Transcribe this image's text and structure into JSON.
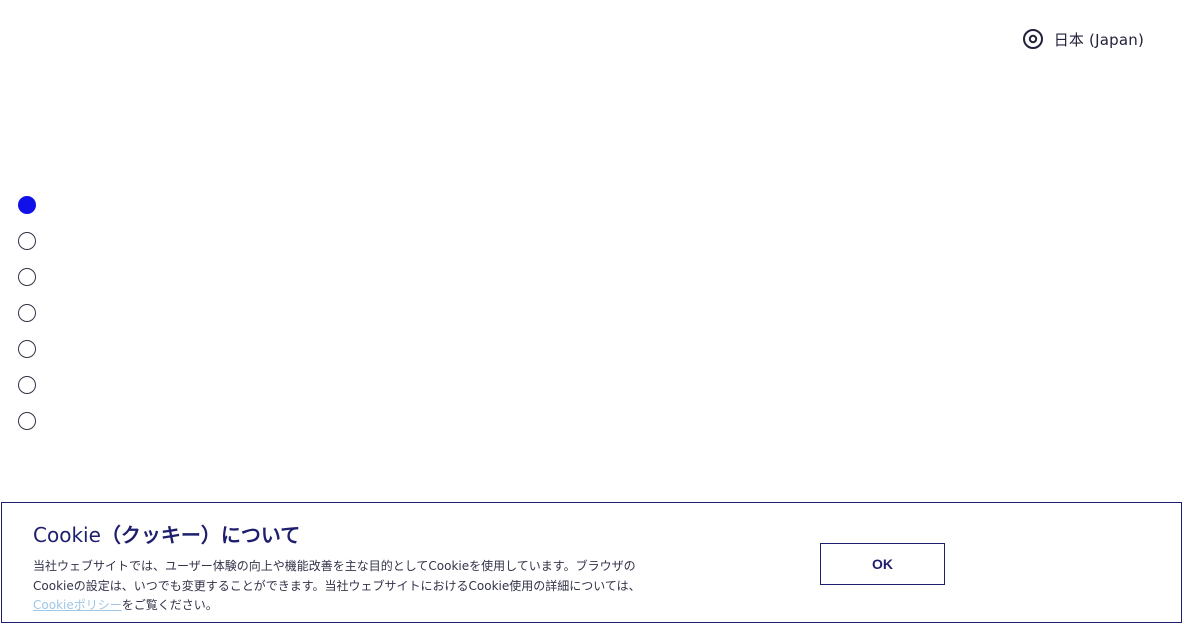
{
  "header": {
    "region_label": "日本 (Japan)",
    "region_icon": "location-pin-icon"
  },
  "carousel": {
    "total_slides": 7,
    "active_index": 0,
    "active_color": "#1010e8"
  },
  "cookie_banner": {
    "title_prefix": "Cookie",
    "title_suffix": "（クッキー）について",
    "body_line1": "当社ウェブサイトでは、ユーザー体験の向上や機能改善を主な目的としてCookieを使用しています。ブラウザの",
    "body_line2": "Cookieの設定は、いつでも変更することができます。当社ウェブサイトにおけるCookie使用の詳細については、",
    "policy_link": "Cookieポリシー",
    "body_line3_suffix": "をご覧ください。",
    "ok_label": "OK",
    "border_color": "#1e1e6e"
  }
}
